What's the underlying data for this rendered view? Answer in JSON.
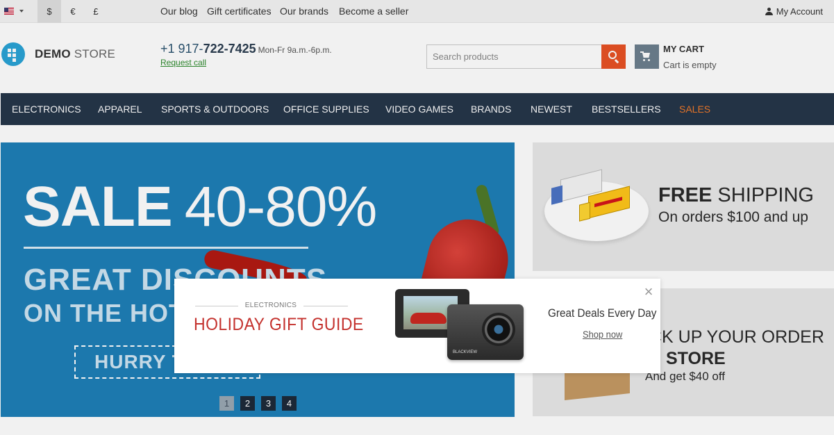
{
  "topbar": {
    "currencies": [
      "$",
      "€",
      "£"
    ],
    "links": [
      "Our blog",
      "Gift certificates",
      "Our brands",
      "Become a seller"
    ],
    "account": "My Account"
  },
  "header": {
    "logo_bold": "DEMO",
    "logo_light": "STORE",
    "phone_prefix": "+1 917-",
    "phone_number": "722-7425",
    "hours": "Mon-Fr 9a.m.-6p.m.",
    "request_call": "Request call",
    "search_placeholder": "Search products",
    "cart_title": "MY CART",
    "cart_status": "Cart is empty"
  },
  "nav": [
    "ELECTRONICS",
    "APPAREL",
    "SPORTS & OUTDOORS",
    "OFFICE SUPPLIES",
    "VIDEO GAMES",
    "BRANDS",
    "NEWEST",
    "BESTSELLERS",
    "SALES"
  ],
  "hero": {
    "sale_word": "SALE",
    "sale_range": "40-80%",
    "line1": "GREAT DISCOUNTS",
    "line2": "ON THE HOT",
    "button": "HURRY T",
    "pages": [
      "1",
      "2",
      "3",
      "4"
    ],
    "active_page": "1"
  },
  "shipping": {
    "title_bold": "FREE",
    "title_rest": "SHIPPING",
    "subtitle": "On orders $100 and up"
  },
  "pickup": {
    "line1": "CK UP YOUR ORDER",
    "line2": "STORE",
    "line3": "And get $40 off"
  },
  "popup": {
    "category": "ELECTRONICS",
    "title": "HOLIDAY GIFT GUIDE",
    "deals": "Great Deals Every Day",
    "shop": "Shop now",
    "close": "×",
    "camera_brand": "BLACKVIEW"
  },
  "colors": {
    "nav_bg": "#26364a",
    "hero_bg": "#1e7fb8",
    "search_button": "#e85225",
    "sale_link": "#f17a2a",
    "popup_title": "#c4312d"
  }
}
